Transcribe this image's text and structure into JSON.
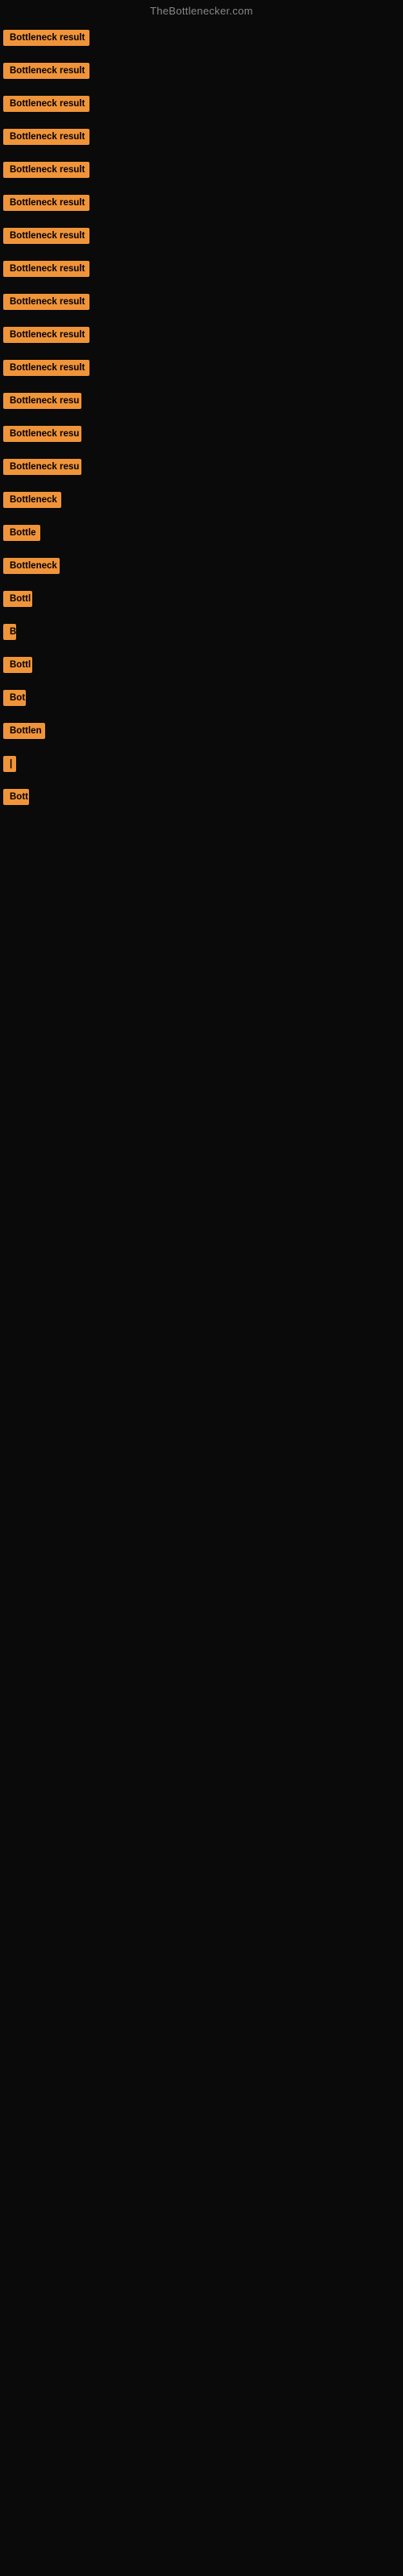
{
  "header": {
    "title": "TheBottlenecker.com"
  },
  "items": [
    {
      "label": "Bottleneck result",
      "width": 107
    },
    {
      "label": "Bottleneck result",
      "width": 107
    },
    {
      "label": "Bottleneck result",
      "width": 107
    },
    {
      "label": "Bottleneck result",
      "width": 107
    },
    {
      "label": "Bottleneck result",
      "width": 107
    },
    {
      "label": "Bottleneck result",
      "width": 107
    },
    {
      "label": "Bottleneck result",
      "width": 107
    },
    {
      "label": "Bottleneck result",
      "width": 107
    },
    {
      "label": "Bottleneck result",
      "width": 107
    },
    {
      "label": "Bottleneck result",
      "width": 107
    },
    {
      "label": "Bottleneck result",
      "width": 107
    },
    {
      "label": "Bottleneck resu",
      "width": 97
    },
    {
      "label": "Bottleneck resu",
      "width": 97
    },
    {
      "label": "Bottleneck resu",
      "width": 97
    },
    {
      "label": "Bottleneck",
      "width": 72
    },
    {
      "label": "Bottle",
      "width": 46
    },
    {
      "label": "Bottleneck",
      "width": 70
    },
    {
      "label": "Bottl",
      "width": 36
    },
    {
      "label": "B",
      "width": 14
    },
    {
      "label": "Bottl",
      "width": 36
    },
    {
      "label": "Bot",
      "width": 28
    },
    {
      "label": "Bottlen",
      "width": 52
    },
    {
      "label": "|",
      "width": 8
    },
    {
      "label": "Bott",
      "width": 32
    }
  ]
}
